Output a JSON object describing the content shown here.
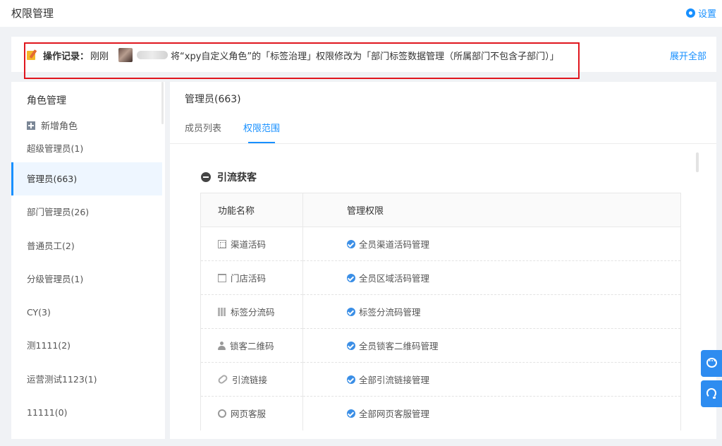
{
  "header": {
    "title": "权限管理",
    "settings_label": "设置"
  },
  "notice": {
    "label": "操作记录：",
    "time": "刚刚",
    "text": "将“xpy自定义角色”的「标签治理」权限修改为「部门标签数据管理（所属部门不包含子部门）」",
    "expand_label": "展开全部"
  },
  "sidebar": {
    "title": "角色管理",
    "add_label": "新增角色",
    "roles": [
      {
        "label": "超级管理员(1)"
      },
      {
        "label": "管理员(663)",
        "active": true
      },
      {
        "label": "部门管理员(26)"
      },
      {
        "label": "普通员工(2)"
      },
      {
        "label": "分级管理员(1)"
      },
      {
        "label": "CY(3)"
      },
      {
        "label": "测1111(2)"
      },
      {
        "label": "运营测试1123(1)"
      },
      {
        "label": "11111(0)"
      }
    ]
  },
  "main": {
    "title": "管理员(663)",
    "tabs": [
      {
        "label": "成员列表"
      },
      {
        "label": "权限范围",
        "active": true
      }
    ],
    "section_title": "引流获客",
    "table": {
      "headers": [
        "功能名称",
        "管理权限"
      ],
      "rows": [
        {
          "icon": "qr-grid-icon",
          "name": "渠道活码",
          "permission": "全员渠道活码管理"
        },
        {
          "icon": "store-icon",
          "name": "门店活码",
          "permission": "全员区域活码管理"
        },
        {
          "icon": "tag-icon",
          "name": "标签分流码",
          "permission": "标签分流码管理"
        },
        {
          "icon": "user-lock-icon",
          "name": "锁客二维码",
          "permission": "全员锁客二维码管理"
        },
        {
          "icon": "link-icon",
          "name": "引流链接",
          "permission": "全部引流链接管理"
        },
        {
          "icon": "chat-icon",
          "name": "网页客服",
          "permission": "全部网页客服管理"
        }
      ]
    }
  },
  "colors": {
    "accent": "#1890ff",
    "highlight_border": "#e0161e",
    "check": "#3a8ee6"
  }
}
